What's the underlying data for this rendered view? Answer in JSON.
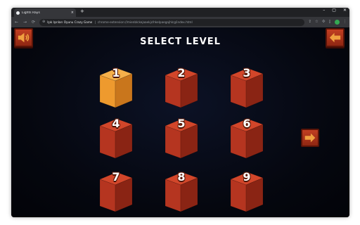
{
  "browser": {
    "tab_title": "Lights Rays",
    "tab_close": "×",
    "new_tab": "+",
    "window_controls": [
      "–",
      "▢",
      "✕"
    ],
    "nav": {
      "back": "←",
      "forward": "→",
      "reload": "⟳"
    },
    "omnibox": {
      "site_name": "Işık Işınları Oyunu Crazy Game",
      "separator": "|",
      "url": "chrome-extension://mienblckejaaekjclhkelpaegajhlcg/index.html"
    },
    "toolbar_icons": [
      "share-icon",
      "star-icon",
      "extensions-icon",
      "sidebar-icon"
    ]
  },
  "game": {
    "title": "SELECT LEVEL",
    "levels": [
      {
        "label": "1",
        "selected": true
      },
      {
        "label": "2",
        "selected": false
      },
      {
        "label": "3",
        "selected": false
      },
      {
        "label": "4",
        "selected": false
      },
      {
        "label": "5",
        "selected": false
      },
      {
        "label": "6",
        "selected": false
      },
      {
        "label": "7",
        "selected": false
      },
      {
        "label": "8",
        "selected": false
      },
      {
        "label": "9",
        "selected": false
      }
    ],
    "colors": {
      "cube_red_top": "#d2462a",
      "cube_red_front": "#b53520",
      "cube_red_side": "#8a2414",
      "cube_orange_top": "#f5b04a",
      "cube_orange_front": "#ee9a2e",
      "cube_orange_side": "#c9761c",
      "button_arrow": "#f0a040"
    },
    "icons": {
      "sound": "speaker-icon",
      "back": "arrow-left-icon",
      "next": "arrow-right-icon"
    }
  }
}
